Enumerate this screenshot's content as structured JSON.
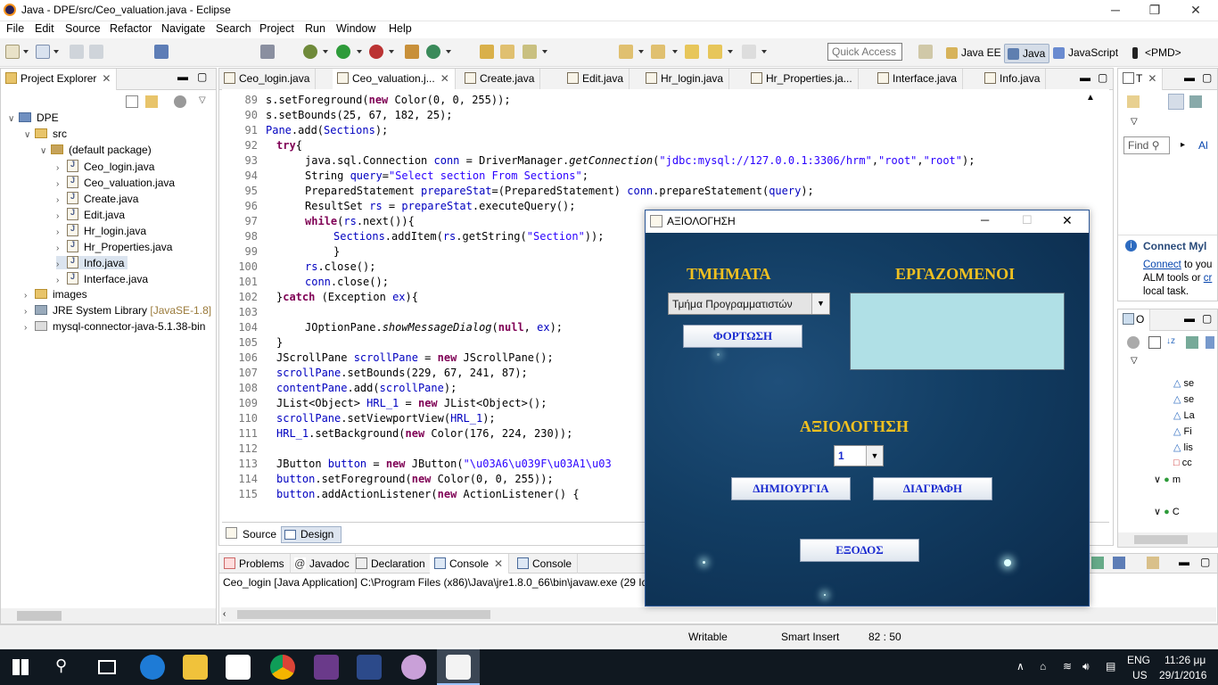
{
  "window": {
    "title": "Java - DPE/src/Ceo_valuation.java - Eclipse"
  },
  "menu": [
    "File",
    "Edit",
    "Source",
    "Refactor",
    "Navigate",
    "Search",
    "Project",
    "Run",
    "Window",
    "Help"
  ],
  "toolbar": {
    "quick_access_placeholder": "Quick Access",
    "perspectives": [
      "Java EE",
      "Java",
      "JavaScript",
      "<PMD>"
    ]
  },
  "project_explorer": {
    "title": "Project Explorer",
    "items": [
      "DPE",
      "src",
      "(default package)",
      "Ceo_login.java",
      "Ceo_valuation.java",
      "Create.java",
      "Edit.java",
      "Hr_login.java",
      "Hr_Properties.java",
      "Info.java",
      "Interface.java",
      "images",
      "JRE System Library",
      "[JavaSE-1.8]",
      "mysql-connector-java-5.1.38-bin"
    ]
  },
  "editor": {
    "tabs": [
      "Ceo_login.java",
      "Ceo_valuation.j...",
      "Create.java",
      "Edit.java",
      "Hr_login.java",
      "Hr_Properties.ja...",
      "Interface.java",
      "Info.java"
    ],
    "line_numbers": [
      "89",
      "90",
      "91",
      "92",
      "93",
      "94",
      "95",
      "96",
      "97",
      "98",
      "99",
      "100",
      "101",
      "102",
      "103",
      "104",
      "105",
      "106",
      "107",
      "108",
      "109",
      "110",
      "111",
      "112",
      "113",
      "114",
      "115"
    ],
    "bottom_tabs": [
      "Source",
      "Design"
    ]
  },
  "right_panel": {
    "tab": "T",
    "find_placeholder": "Find",
    "all": "Al",
    "connect_title": "Connect Myl",
    "connect_link": "Connect",
    "connect_text1": " to you",
    "connect_text2": "ALM tools or ",
    "connect_text3": "cr",
    "connect_text4": "local task.",
    "outline_tab": "O",
    "outline_items": [
      "se",
      "se",
      "La",
      "Fi",
      "lis",
      "cc",
      "m",
      "C"
    ]
  },
  "console": {
    "tabs": [
      "Problems",
      "Javadoc",
      "Declaration",
      "Console",
      "Console"
    ],
    "text": "Ceo_login [Java Application] C:\\Program Files (x86)\\Java\\jre1.8.0_66\\bin\\javaw.exe (29 Іαν"
  },
  "dialog": {
    "title": "ΑΞΙΟΛΟΓΗΣΗ",
    "departments_label": "ΤΜΗΜΑΤΑ",
    "employees_label": "ΕΡΓΑΖΟΜΕΝΟΙ",
    "department_value": "Τμήμα Προγραμματιστών",
    "load_button": "ΦΟΡΤΩΣΗ",
    "evaluation_label": "ΑΞΙΟΛΟΓΗΣΗ",
    "score_value": "1",
    "create_button": "ΔΗΜΙΟΥΡΓΙΑ",
    "delete_button": "ΔΙΑΓΡΑΦΗ",
    "exit_button": "ΕΞΟΔΟΣ"
  },
  "status": {
    "writable": "Writable",
    "insert": "Smart Insert",
    "position": "82 : 50"
  },
  "taskbar": {
    "lang1": "ENG",
    "lang2": "US",
    "time": "11:26 μμ",
    "date": "29/1/2016"
  }
}
